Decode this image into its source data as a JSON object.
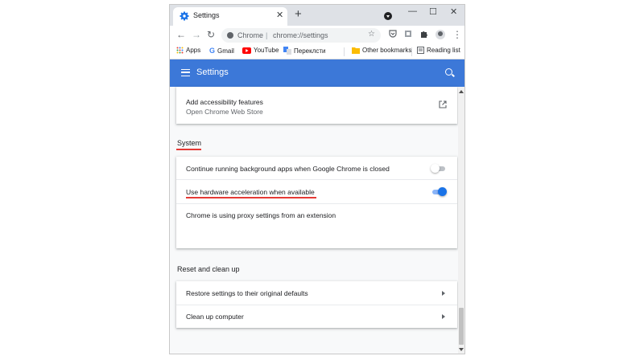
{
  "colors": {
    "accent": "#3c78d8",
    "toggle_on": "#1a73e8",
    "annotation": "#e53935"
  },
  "tab": {
    "title": "Settings",
    "close": "✕",
    "new_tab": "+",
    "icon": "gear-icon"
  },
  "window_controls": {
    "minimize": "—",
    "maximize": "☐",
    "close": "✕"
  },
  "toolbar": {
    "back": "←",
    "forward": "→",
    "reload": "↻",
    "omnibox_site": "Chrome",
    "omnibox_separator": "|",
    "omnibox_url": "chrome://settings",
    "star": "☆",
    "menu": "⋮"
  },
  "bookmarks": {
    "items": [
      {
        "label": "Apps",
        "icon": "apps-grid-icon"
      },
      {
        "label": "Gmail",
        "icon": "google-icon"
      },
      {
        "label": "YouTube",
        "icon": "youtube-icon"
      },
      {
        "label": "Переклсти",
        "icon": "translate-icon"
      }
    ],
    "other_bookmarks": "Other bookmarks",
    "reading_list": "Reading list"
  },
  "header": {
    "title": "Settings"
  },
  "accessibility_card": {
    "title": "Add accessibility features",
    "subtitle": "Open Chrome Web Store"
  },
  "system": {
    "title": "System",
    "rows": [
      {
        "label": "Continue running background apps when Google Chrome is closed",
        "enabled": false
      },
      {
        "label": "Use hardware acceleration when available",
        "enabled": true
      }
    ],
    "proxy_note": "Chrome is using proxy settings from an extension"
  },
  "reset": {
    "title": "Reset and clean up",
    "rows": [
      {
        "label": "Restore settings to their original defaults"
      },
      {
        "label": "Clean up computer"
      }
    ]
  }
}
